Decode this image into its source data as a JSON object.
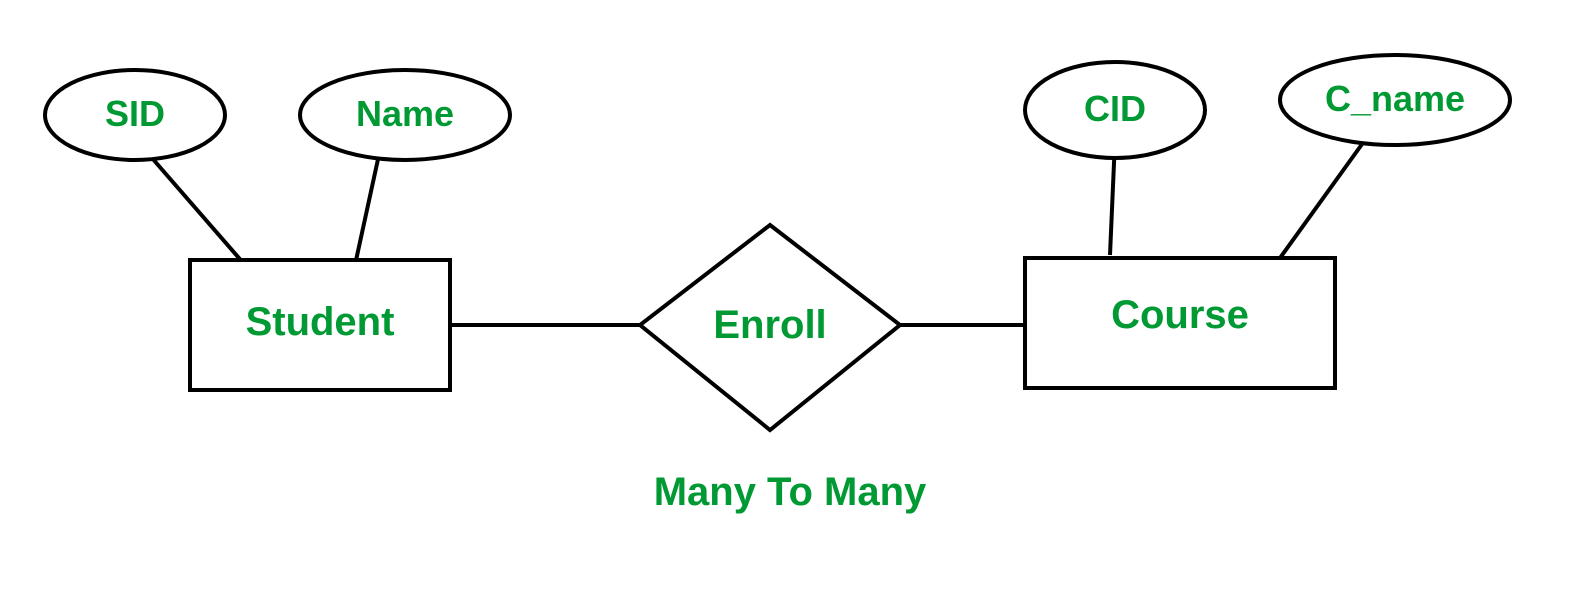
{
  "entities": {
    "student": {
      "label": "Student",
      "attributes": {
        "sid": "SID",
        "name": "Name"
      }
    },
    "course": {
      "label": "Course",
      "attributes": {
        "cid": "CID",
        "cname": "C_name"
      }
    }
  },
  "relationship": {
    "enroll": "Enroll"
  },
  "caption": "Many To Many"
}
